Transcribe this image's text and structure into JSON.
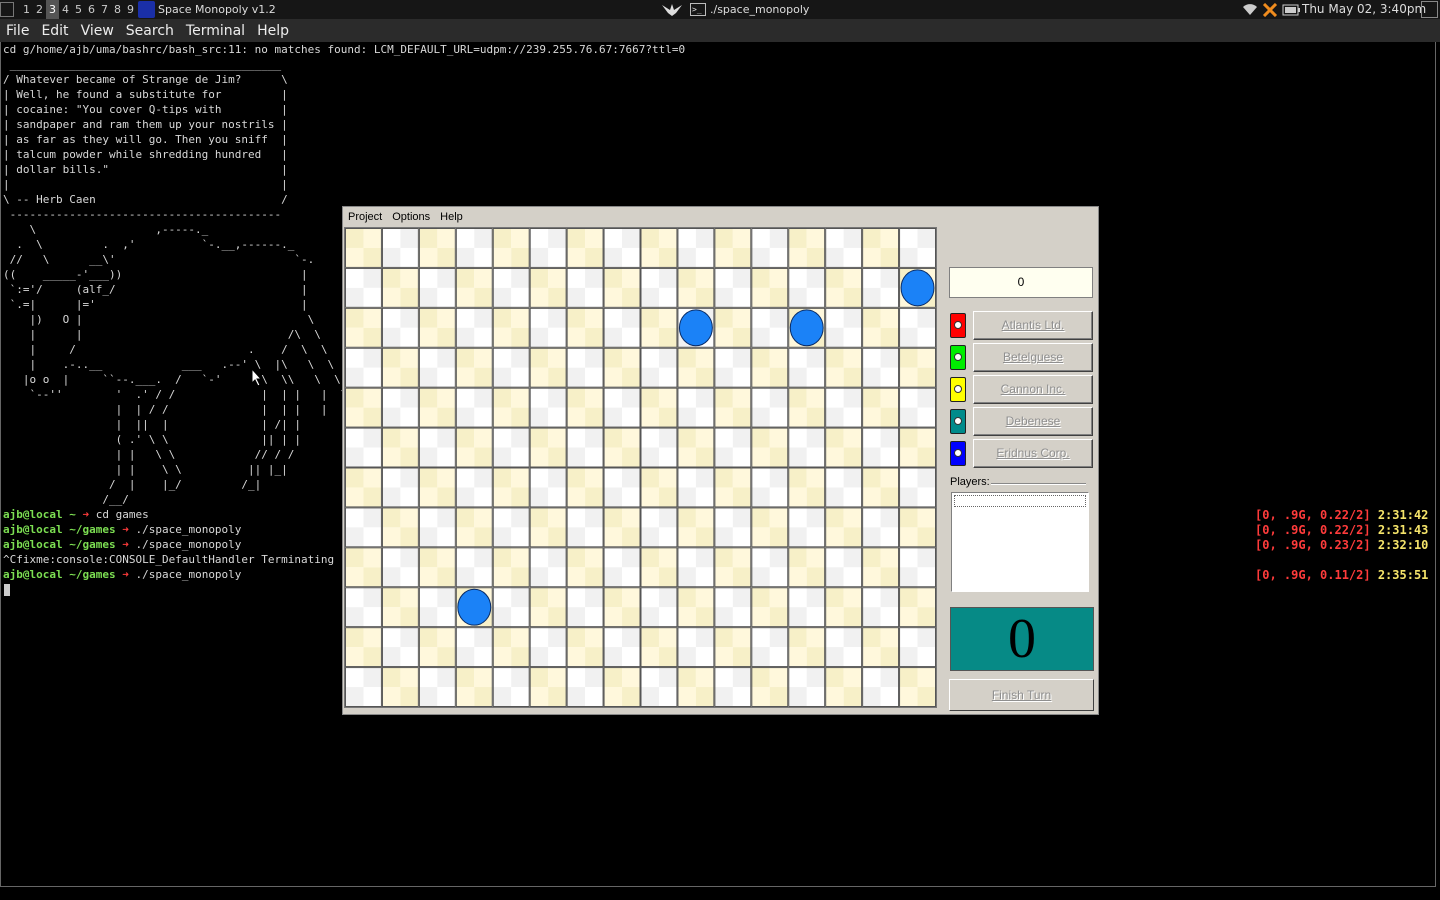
{
  "top_panel": {
    "workspaces": [
      "1",
      "2",
      "3",
      "4",
      "5",
      "6",
      "7",
      "8",
      "9"
    ],
    "active_workspace": "3",
    "app_title": "Space Monopoly v1.2",
    "task_title": "./space_monopoly",
    "term_icon": ">_",
    "clock": "Thu May 02,  3:40pm",
    "tray_icons": [
      "wifi-icon",
      "x-icon",
      "battery-icon"
    ]
  },
  "terminal": {
    "menus": [
      "File",
      "Edit",
      "View",
      "Search",
      "Terminal",
      "Help"
    ],
    "error_line": "cd g/home/ajb/uma/bashrc/bash_src:11: no matches found: LCM_DEFAULT_URL=udpm://239.255.76.67:7667?ttl=0",
    "cowsay": " _________________________________________\n/ Whatever became of Strange de Jim?      \\\n| Well, he found a substitute for         |\n| cocaine: \"You cover Q-tips with         |\n| sandpaper and ram them up your nostrils |\n| as far as they will go. Then you sniff  |\n| talcum powder while shredding hundred   |\n| dollar bills.\"                          |\n|                                         |\n\\ -- Herb Caen                            /\n -----------------------------------------\n    \\                  ,-----._\n  .  \\         .  ,'          `-.__,------._\n //   \\      __\\'                           `-.\n((    _____-'___))                           |\n `:='/     (alf_/                            |\n `.=|      |='                               |\n    |)   O |                                  \\\n    |      |                               /\\  \\\n    |     /                          .    /  \\  \\\n    |    .-..__            ___   .--' \\  |\\   \\  \\\n   |o o  |     ``--.___.  /   `-'      \\  \\\\   \\  \\\n    `--''        '  .' / /             |  | |   |  \\\n                 |  | / /              |  | |   |  '\n                 |  ||  |              | /| |\n                 ( .' \\ \\              || | |\n                 | |   \\ \\            // / /\n                 | |    \\ \\          || |_|\n                /  |    |_/         /_|\n               /__/",
    "cmd_lines": [
      {
        "prompt": "ajb@local ~ ",
        "arrow": "➜",
        "cmd": " cd games"
      },
      {
        "prompt": "ajb@local ~/games ",
        "arrow": "➜",
        "cmd": " ./space_monopoly"
      },
      {
        "prompt": "ajb@local ~/games ",
        "arrow": "➜",
        "cmd": " ./space_monopoly"
      },
      {
        "prompt": "",
        "arrow": "",
        "cmd": "^Cfixme:console:CONSOLE_DefaultHandler Terminating"
      },
      {
        "prompt": "ajb@local ~/games ",
        "arrow": "➜",
        "cmd": " ./space_monopoly"
      }
    ],
    "timestamps": [
      {
        "stat": "[0, .9G, 0.22/2]",
        "time": "2:31:42"
      },
      {
        "stat": "[0, .9G, 0.22/2]",
        "time": "2:31:43"
      },
      {
        "stat": "[0, .9G, 0.23/2]",
        "time": "2:32:10"
      },
      {
        "stat": "",
        "time": ""
      },
      {
        "stat": "[0, .9G, 0.11/2]",
        "time": "2:35:51"
      }
    ]
  },
  "game": {
    "menus": [
      "Project",
      "Options",
      "Help"
    ],
    "board": {
      "cols": 16,
      "rows": 12,
      "tokens": [
        {
          "col": 15,
          "row": 1
        },
        {
          "col": 9,
          "row": 2
        },
        {
          "col": 12,
          "row": 2
        },
        {
          "col": 3,
          "row": 9
        }
      ],
      "token_color": "#1b82f7",
      "cell_color_a": "#f7f0c8",
      "cell_color_b": "#ffffff"
    },
    "money": "0",
    "companies": [
      {
        "name": "Atlantis Ltd.",
        "color": "#ff0000"
      },
      {
        "name": "Betelguese",
        "color": "#00ee00"
      },
      {
        "name": "Cannon Inc.",
        "color": "#ffff00"
      },
      {
        "name": "Debenese",
        "color": "#008b8b"
      },
      {
        "name": "Eridnus Corp.",
        "color": "#0000ff"
      }
    ],
    "players_label": "Players:",
    "dice": "0",
    "finish_turn": "Finish Turn"
  }
}
